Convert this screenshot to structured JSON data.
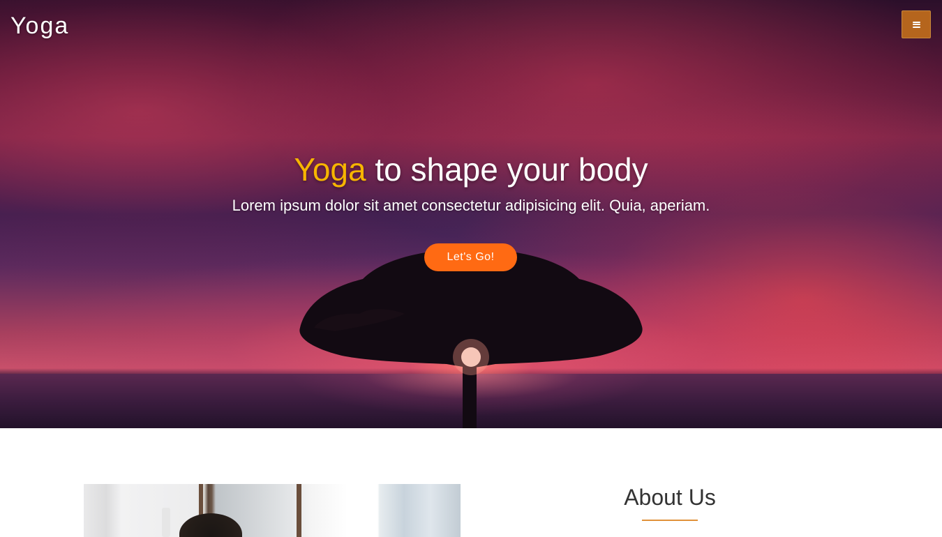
{
  "nav": {
    "brand": "Yoga",
    "menu_icon": "hamburger-menu-icon"
  },
  "hero": {
    "headline_accent": "Yoga",
    "headline_rest": " to shape your body",
    "subhead": "Lorem ipsum dolor sit amet consectetur adipisicing elit. Quia, aperiam.",
    "cta_label": "Let's Go!"
  },
  "about": {
    "title": "About Us"
  },
  "colors": {
    "accent_yellow": "#f7b500",
    "cta_orange": "#ff6a13",
    "menu_button": "#b5651d",
    "rule": "#e0913a"
  }
}
